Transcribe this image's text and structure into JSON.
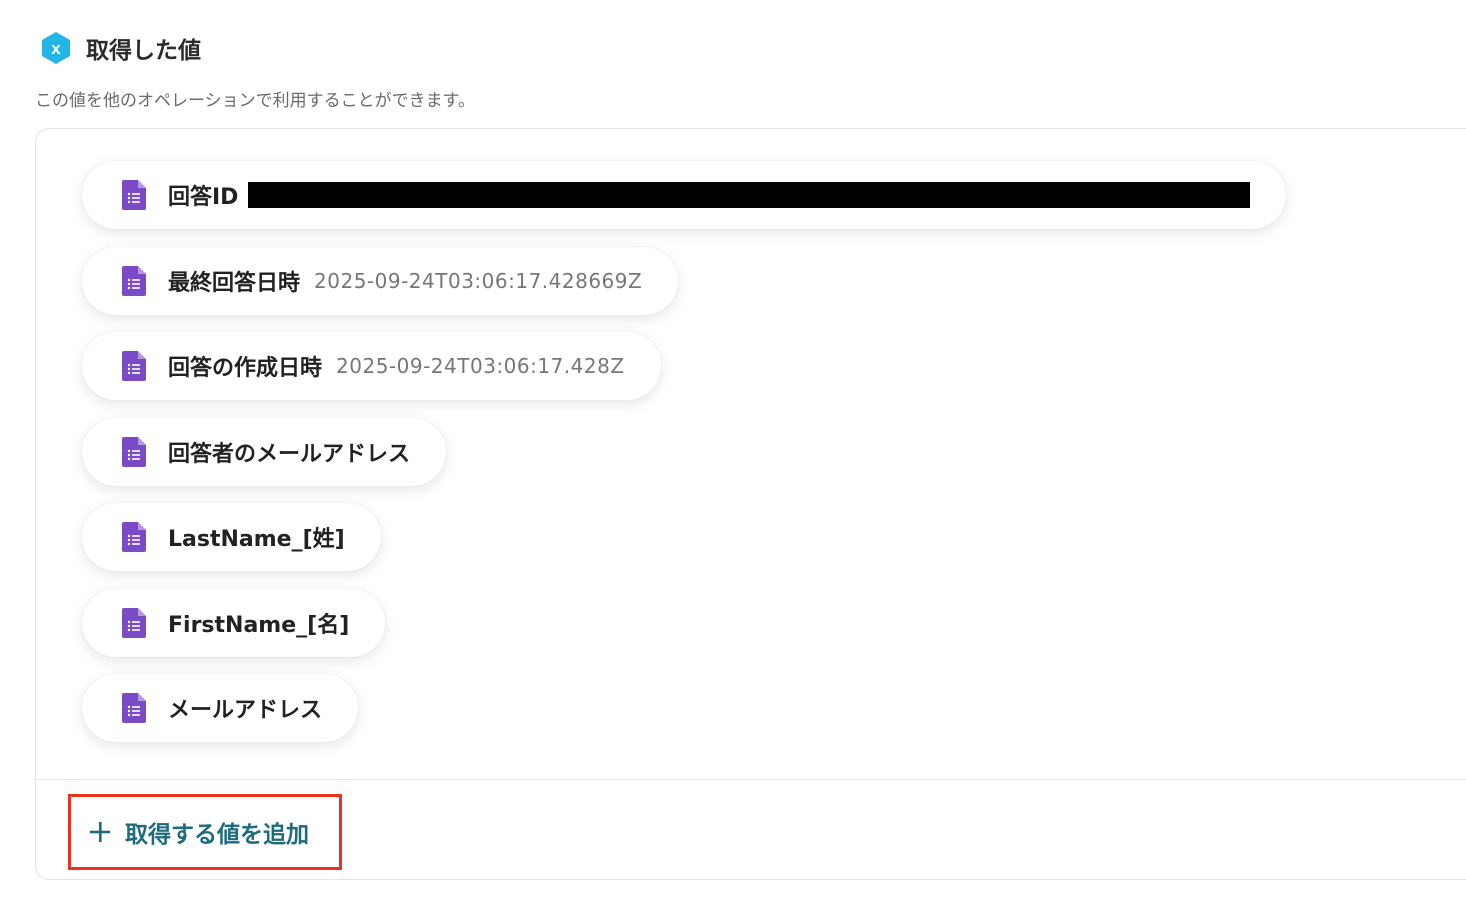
{
  "header": {
    "badge_icon": "variable-x-icon",
    "title": "取得した値",
    "subtitle": "この値を他のオペレーションで利用することができます。"
  },
  "fields": [
    {
      "label": "回答ID",
      "value": "",
      "redacted": true
    },
    {
      "label": "最終回答日時",
      "value": "2025-09-24T03:06:17.428669Z"
    },
    {
      "label": "回答の作成日時",
      "value": "2025-09-24T03:06:17.428Z"
    },
    {
      "label": "回答者のメールアドレス",
      "value": ""
    },
    {
      "label": "LastName_[姓]",
      "value": ""
    },
    {
      "label": "FirstName_[名]",
      "value": ""
    },
    {
      "label": "メールアドレス",
      "value": ""
    }
  ],
  "add_button": {
    "icon": "plus-icon",
    "label": "取得する値を追加"
  },
  "colors": {
    "badge": "#22b5e6",
    "doc_icon": "#7a4bc4",
    "add_label": "#1d6b7c",
    "highlight_border": "#e8311f"
  }
}
